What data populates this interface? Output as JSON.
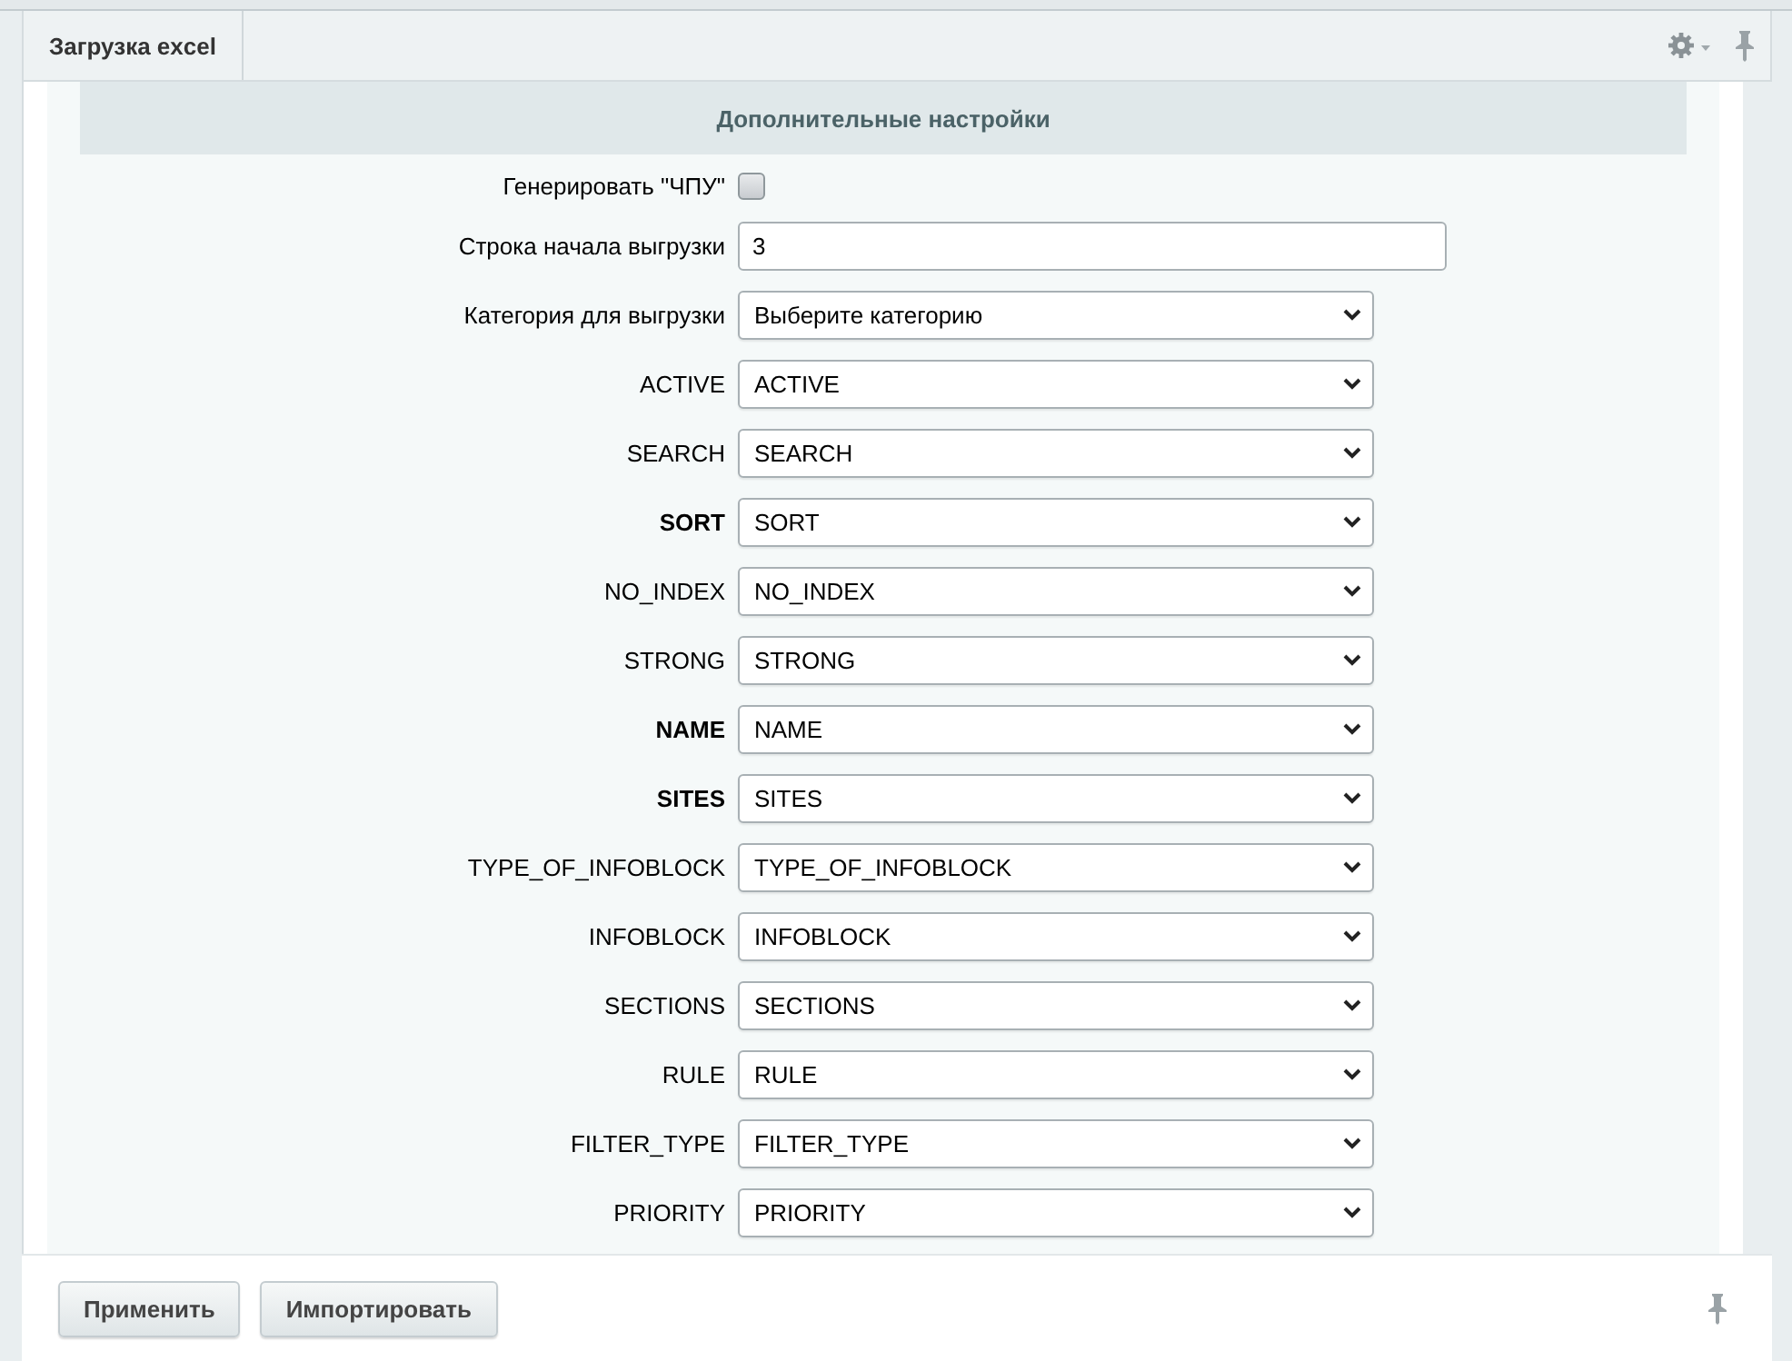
{
  "tabs": [
    {
      "label": "Загрузка excel"
    }
  ],
  "section_title": "Дополнительные настройки",
  "fields": [
    {
      "kind": "checkbox",
      "label": "Генерировать \"ЧПУ\"",
      "required": false,
      "checked": false
    },
    {
      "kind": "text",
      "label": "Строка начала выгрузки",
      "required": false,
      "value": "3"
    },
    {
      "kind": "select",
      "label": "Категория для выгрузки",
      "required": false,
      "value": "Выберите категорию"
    },
    {
      "kind": "select",
      "label": "ACTIVE",
      "required": false,
      "value": "ACTIVE"
    },
    {
      "kind": "select",
      "label": "SEARCH",
      "required": false,
      "value": "SEARCH"
    },
    {
      "kind": "select",
      "label": "SORT",
      "required": true,
      "value": "SORT"
    },
    {
      "kind": "select",
      "label": "NO_INDEX",
      "required": false,
      "value": "NO_INDEX"
    },
    {
      "kind": "select",
      "label": "STRONG",
      "required": false,
      "value": "STRONG"
    },
    {
      "kind": "select",
      "label": "NAME",
      "required": true,
      "value": "NAME"
    },
    {
      "kind": "select",
      "label": "SITES",
      "required": true,
      "value": "SITES"
    },
    {
      "kind": "select",
      "label": "TYPE_OF_INFOBLOCK",
      "required": false,
      "value": "TYPE_OF_INFOBLOCK"
    },
    {
      "kind": "select",
      "label": "INFOBLOCK",
      "required": false,
      "value": "INFOBLOCK"
    },
    {
      "kind": "select",
      "label": "SECTIONS",
      "required": false,
      "value": "SECTIONS"
    },
    {
      "kind": "select",
      "label": "RULE",
      "required": false,
      "value": "RULE"
    },
    {
      "kind": "select",
      "label": "FILTER_TYPE",
      "required": false,
      "value": "FILTER_TYPE"
    },
    {
      "kind": "select",
      "label": "PRIORITY",
      "required": false,
      "value": "PRIORITY"
    }
  ],
  "buttons": [
    "Применить",
    "Импортировать"
  ]
}
